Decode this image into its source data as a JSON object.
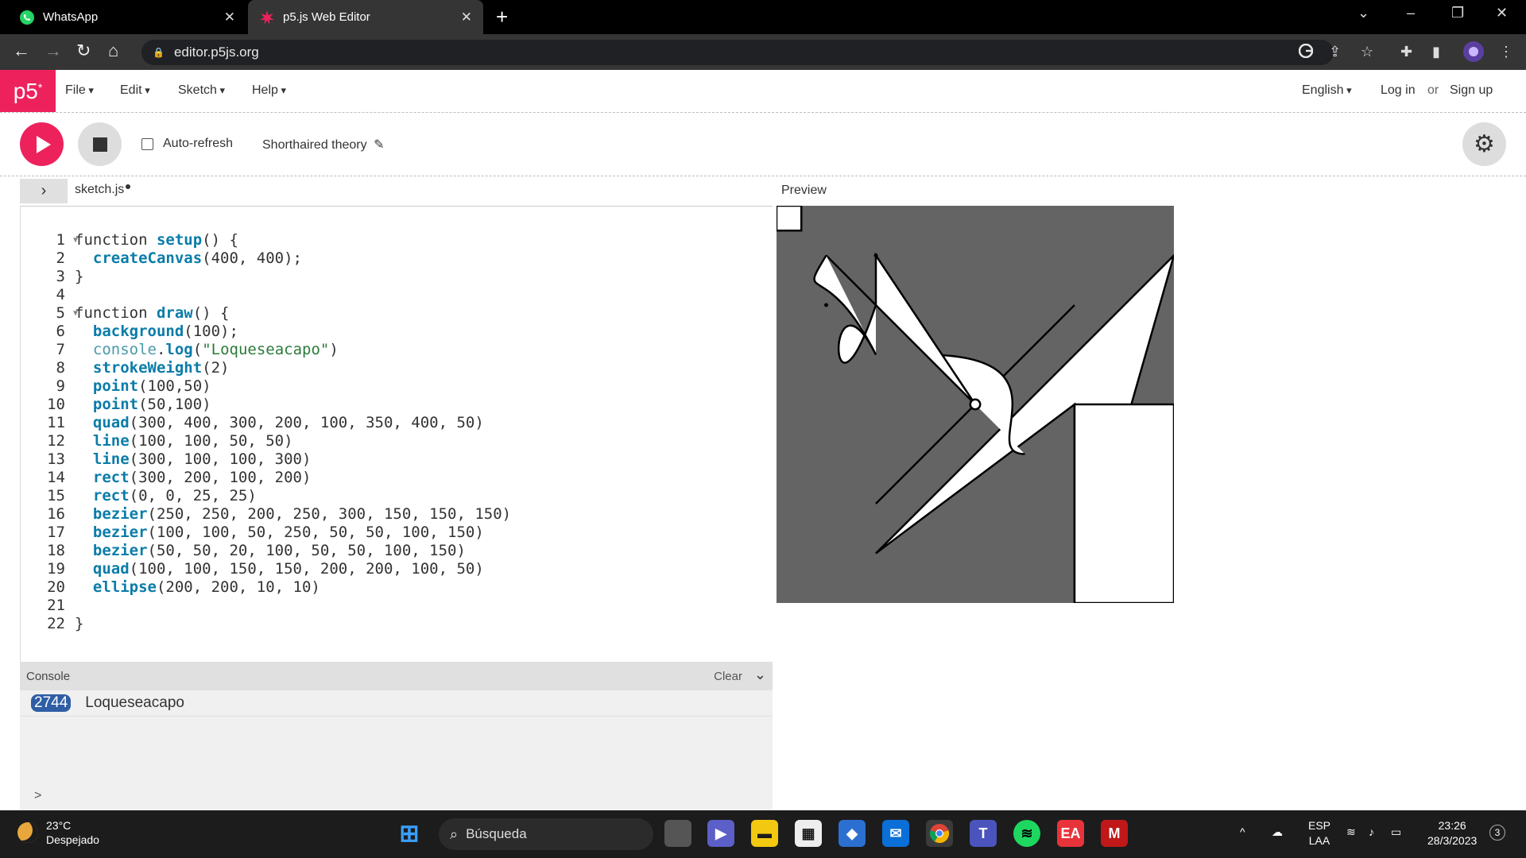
{
  "browser": {
    "tabs": [
      {
        "title": "WhatsApp",
        "icon": "whatsapp-icon"
      },
      {
        "title": "p5.js Web Editor",
        "icon": "p5-asterisk-icon"
      }
    ],
    "url": "editor.p5js.org"
  },
  "p5": {
    "logo": "p5",
    "menus": [
      "File",
      "Edit",
      "Sketch",
      "Help"
    ],
    "language": "English",
    "login": "Log in",
    "or": "or",
    "signup": "Sign up",
    "auto_refresh_label": "Auto-refresh",
    "sketch_name": "Shorthaired theory",
    "file_name": "sketch.js",
    "preview_label": "Preview"
  },
  "code": {
    "line_numbers": [
      "1",
      "2",
      "3",
      "4",
      "5",
      "6",
      "7",
      "8",
      "9",
      "10",
      "11",
      "12",
      "13",
      "14",
      "15",
      "16",
      "17",
      "18",
      "19",
      "20",
      "21",
      "22"
    ]
  },
  "console": {
    "title": "Console",
    "clear": "Clear",
    "count": "2744",
    "message": "Loqueseacapo",
    "prompt": ">"
  },
  "taskbar": {
    "temperature": "23°C",
    "weather": "Despejado",
    "search_placeholder": "Búsqueda",
    "lang_top": "ESP",
    "lang_bottom": "LAA",
    "time": "23:26",
    "date": "28/3/2023",
    "notifications": "3"
  }
}
